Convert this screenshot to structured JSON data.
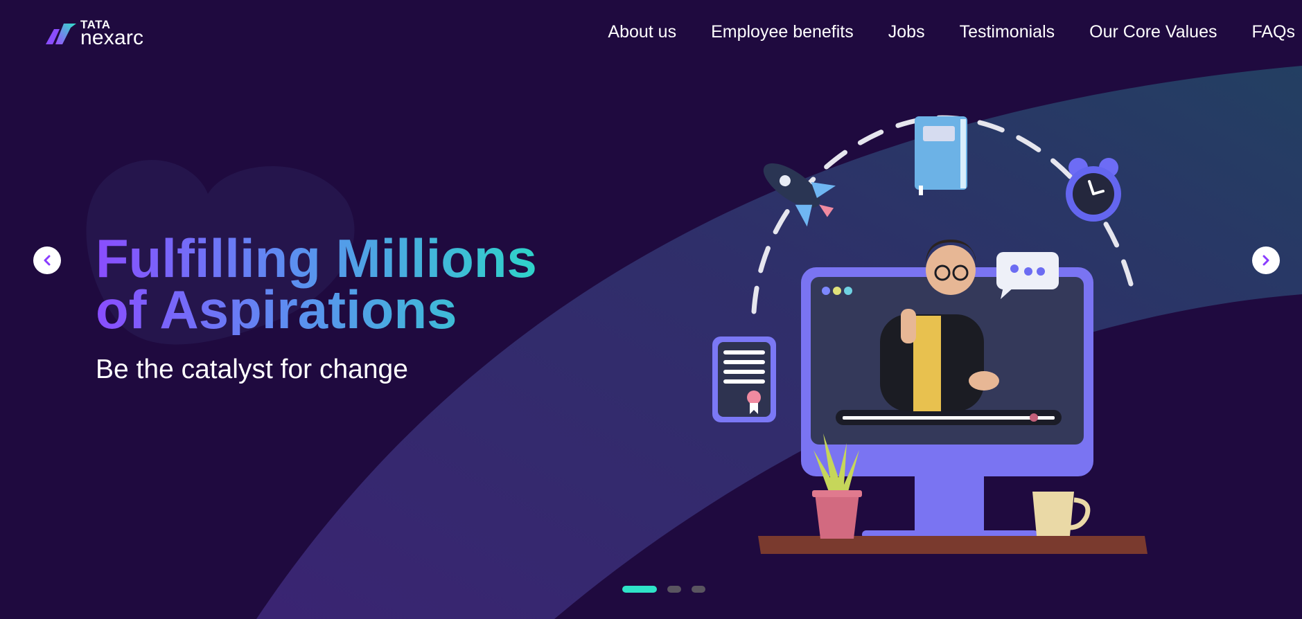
{
  "brand": {
    "tata": "TATA",
    "nexarc": "nexarc"
  },
  "nav": {
    "items": [
      {
        "label": "About us"
      },
      {
        "label": "Employee benefits"
      },
      {
        "label": "Jobs"
      },
      {
        "label": "Testimonials"
      },
      {
        "label": "Our Core Values"
      },
      {
        "label": "FAQs"
      }
    ]
  },
  "hero": {
    "headline_line1": "Fulfilling Millions",
    "headline_line2": "of Aspirations",
    "subtitle": "Be the catalyst for change"
  },
  "carousel": {
    "slide_count": 3,
    "active_slide": 1,
    "prev_icon": "chevron-left-icon",
    "next_icon": "chevron-right-icon"
  },
  "colors": {
    "background": "#1f0a3f",
    "accent_teal": "#2fe3c8",
    "accent_purple": "#8a4dff",
    "wave_blue": "#26415f"
  }
}
